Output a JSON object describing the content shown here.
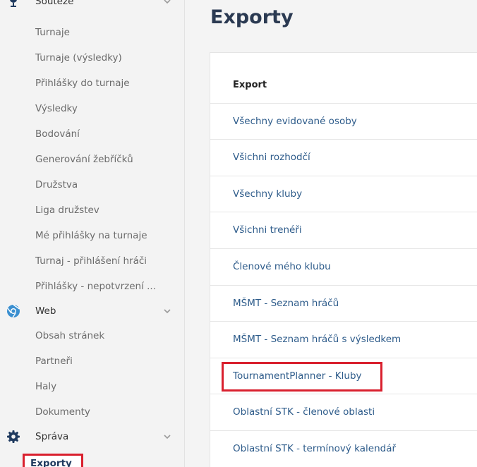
{
  "sidebar": {
    "top_section_label": "Soutěže",
    "competition_items": [
      "Turnaje",
      "Turnaje (výsledky)",
      "Přihlášky do turnaje",
      "Výsledky",
      "Bodování",
      "Generování žebříčků",
      "Družstva",
      "Liga družstev",
      "Mé přihlášky na turnaje",
      "Turnaj - přihlášení hráči",
      "Přihlášky - nepotvrzení ..."
    ],
    "web_section_label": "Web",
    "web_items": [
      "Obsah stránek",
      "Partneři",
      "Haly",
      "Dokumenty"
    ],
    "admin_section_label": "Správa",
    "active_item": "Exporty"
  },
  "main": {
    "title": "Exporty",
    "table_header": "Export",
    "rows": [
      "Všechny evidované osoby",
      "Všichni rozhodčí",
      "Všechny kluby",
      "Všichni trenéři",
      "Členové mého klubu",
      "MŠMT - Seznam hráčů",
      "MŠMT - Seznam hráčů s výsledkem",
      "TournamentPlanner - Kluby",
      "Oblastní STK - členové oblasti",
      "Oblastní STK - termínový kalendář"
    ]
  },
  "colors": {
    "link": "#2d5b8a",
    "highlight": "#d9202e",
    "web_icon": "#3a8fd0",
    "gear_icon": "#1f3a5f"
  }
}
